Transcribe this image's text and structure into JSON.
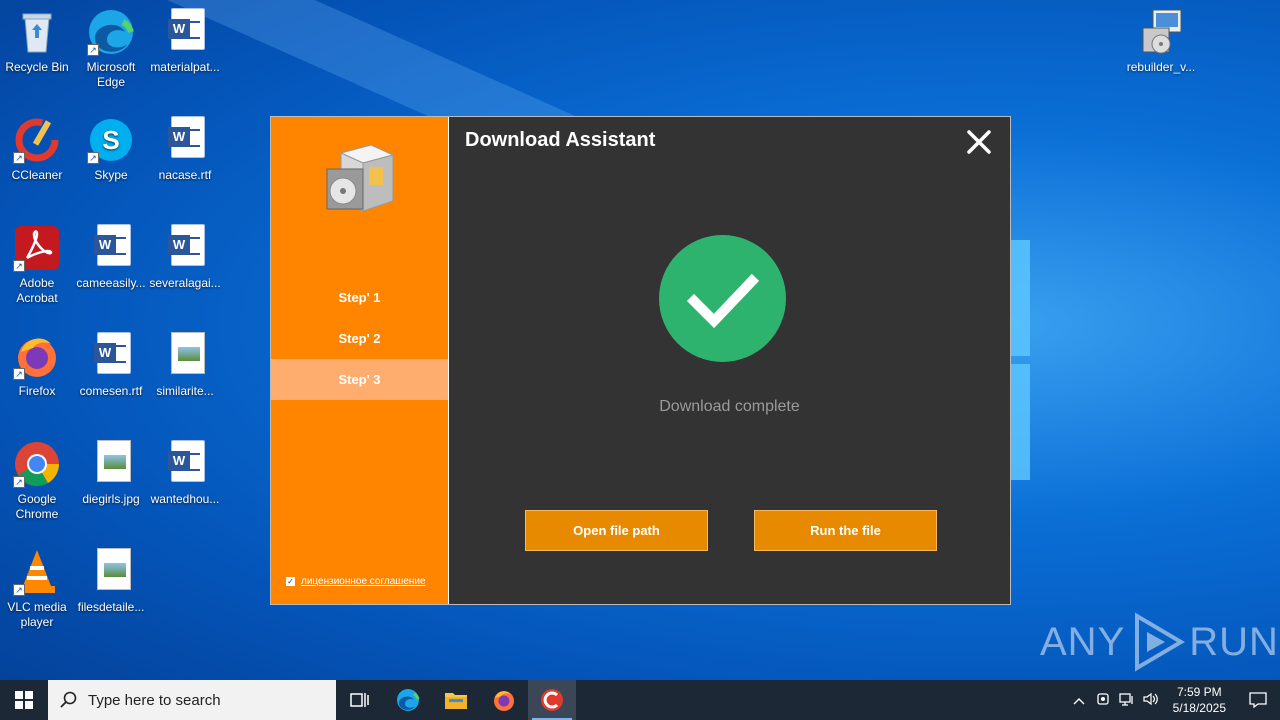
{
  "desktop": {
    "icons": [
      {
        "label": "Recycle Bin"
      },
      {
        "label": "Microsoft Edge"
      },
      {
        "label": "materialpat..."
      },
      {
        "label": "CCleaner"
      },
      {
        "label": "Skype"
      },
      {
        "label": "nacase.rtf"
      },
      {
        "label": "Adobe Acrobat"
      },
      {
        "label": "cameeasily..."
      },
      {
        "label": "severalagai..."
      },
      {
        "label": "Firefox"
      },
      {
        "label": "comesen.rtf"
      },
      {
        "label": "similarite..."
      },
      {
        "label": "Google Chrome"
      },
      {
        "label": "diegirls.jpg"
      },
      {
        "label": "wantedhou..."
      },
      {
        "label": "VLC media player"
      },
      {
        "label": "filesdetaile..."
      },
      {
        "label": "rebuilder_v..."
      }
    ]
  },
  "dialog": {
    "title": "Download Assistant",
    "steps": [
      "Step' 1",
      "Step' 2",
      "Step' 3"
    ],
    "active_step": 3,
    "status": "Download complete",
    "open_button": "Open file path",
    "run_button": "Run the file",
    "license_text": "лицензионное соглашение",
    "license_checked": true,
    "accent": "#ff8400",
    "success_color": "#2db36e"
  },
  "watermark": {
    "left": "ANY",
    "right": "RUN"
  },
  "taskbar": {
    "search_placeholder": "Type here to search",
    "time": "7:59 PM",
    "date": "5/18/2025"
  }
}
